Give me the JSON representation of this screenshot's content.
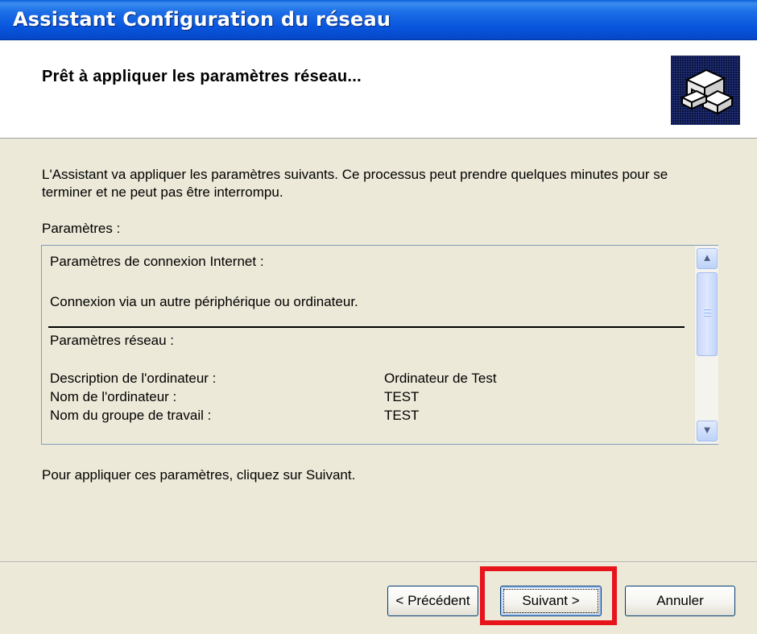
{
  "window": {
    "title": "Assistant Configuration du réseau"
  },
  "header": {
    "title": "Prêt à appliquer les paramètres réseau...",
    "icon": "network-computers-icon"
  },
  "body": {
    "intro": "L'Assistant va appliquer les paramètres suivants. Ce processus peut prendre quelques minutes pour se terminer et ne peut pas être interrompu.",
    "params_label": "Paramètres :",
    "list": {
      "internet_heading": "Paramètres de connexion Internet :",
      "connection": "Connexion via un autre périphérique ou ordinateur.",
      "network_heading": "Paramètres réseau :",
      "rows": [
        {
          "label": "Description de l'ordinateur :",
          "value": "Ordinateur de Test"
        },
        {
          "label": "Nom de l'ordinateur :",
          "value": "TEST"
        },
        {
          "label": "Nom du groupe de travail :",
          "value": "TEST"
        }
      ]
    },
    "footer": "Pour appliquer ces paramètres, cliquez sur Suivant."
  },
  "buttons": {
    "prev": "< Précédent",
    "next": "Suivant >",
    "cancel": "Annuler"
  },
  "colors": {
    "titlebar": "#0855DD",
    "highlight": "#E8141C",
    "dialog_bg": "#ECE9D8"
  }
}
